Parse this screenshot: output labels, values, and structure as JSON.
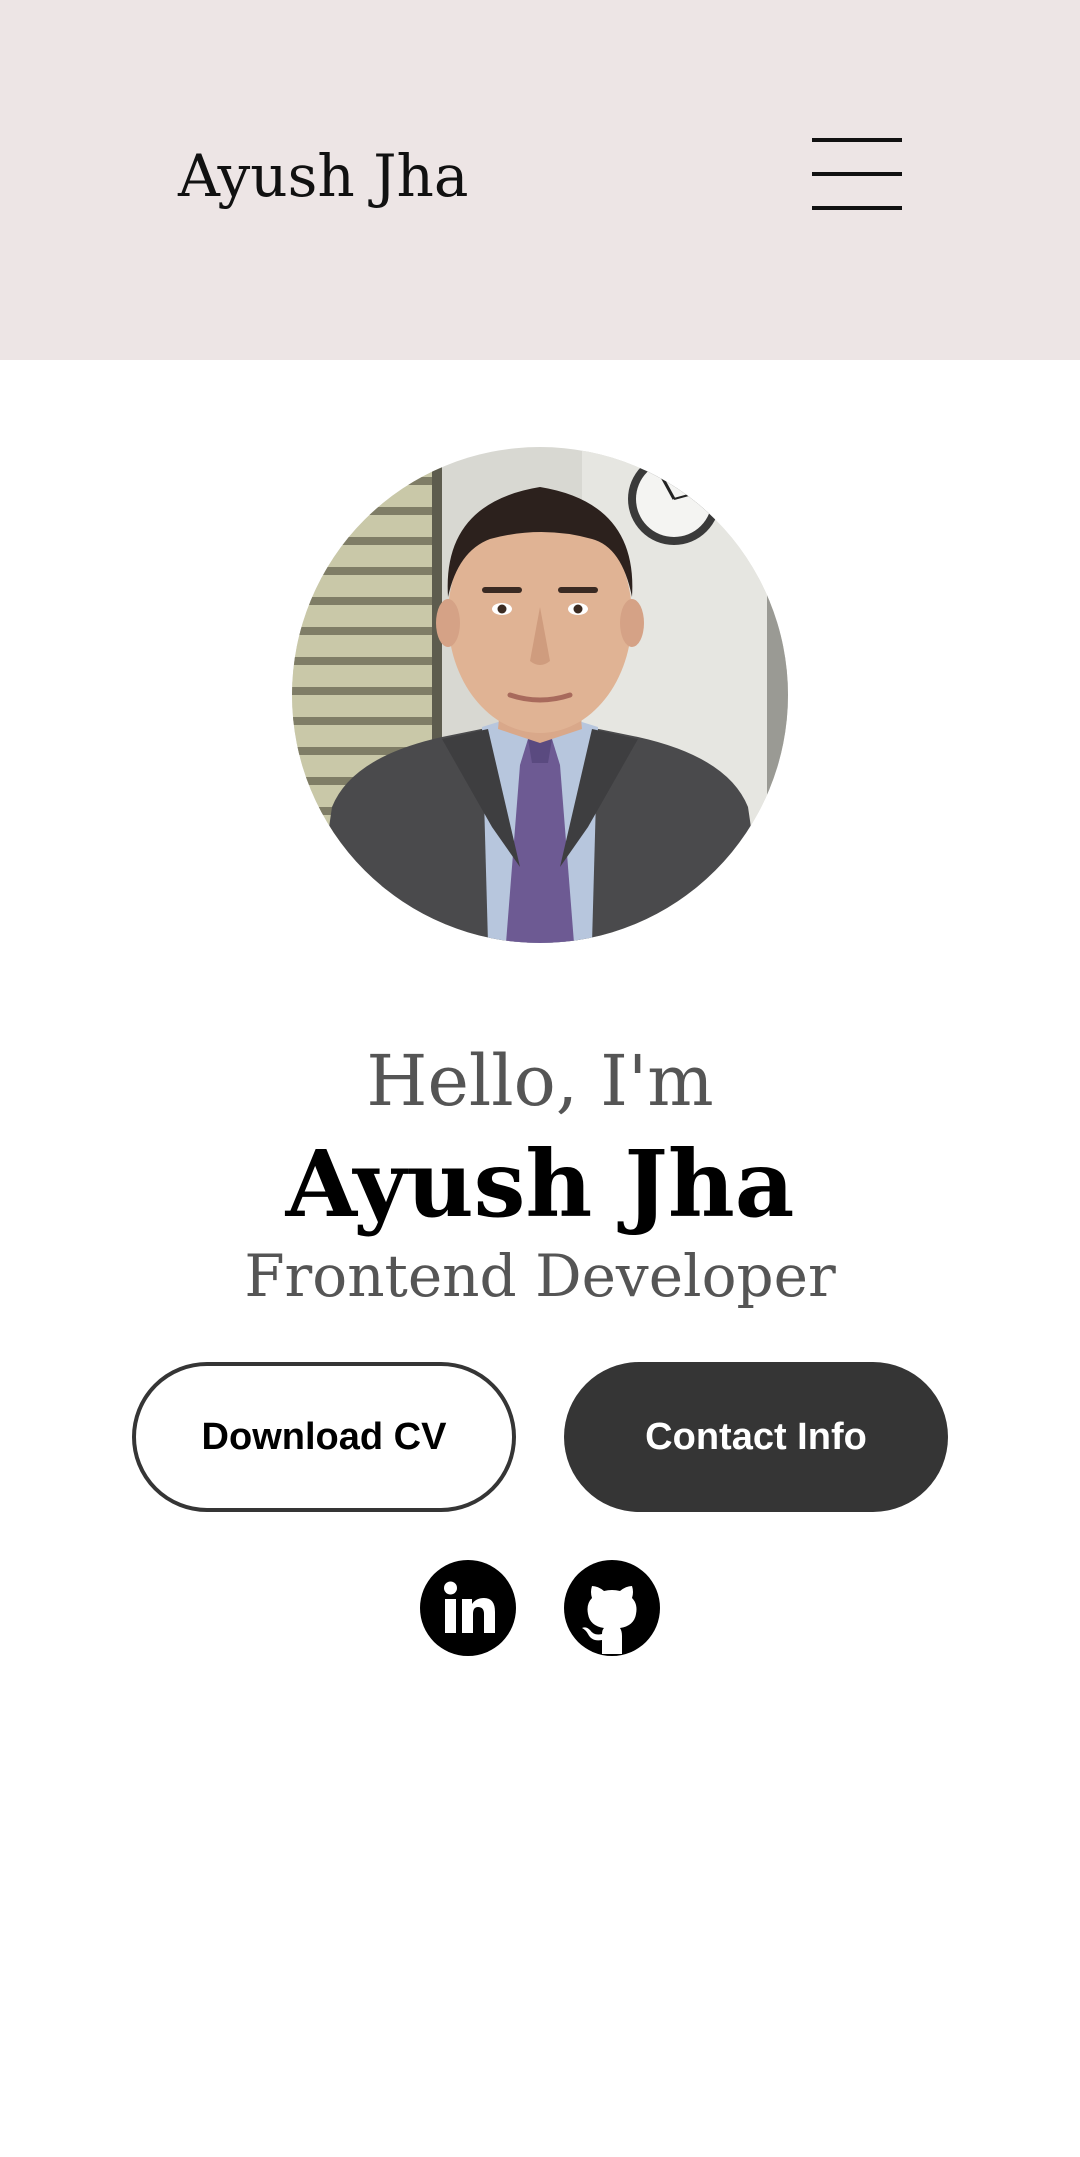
{
  "header": {
    "logo": "Ayush Jha",
    "menu_icon": "hamburger-menu-icon",
    "background_color": "#ede5e5"
  },
  "profile": {
    "avatar_alt": "profile picture"
  },
  "hero": {
    "greeting": "Hello, I'm",
    "name": "Ayush Jha",
    "role": "Frontend Developer"
  },
  "buttons": {
    "download_cv": "Download CV",
    "contact_info": "Contact Info",
    "solid_color": "#353535"
  },
  "social": {
    "linkedin_icon": "linkedin-icon",
    "github_icon": "github-icon"
  }
}
